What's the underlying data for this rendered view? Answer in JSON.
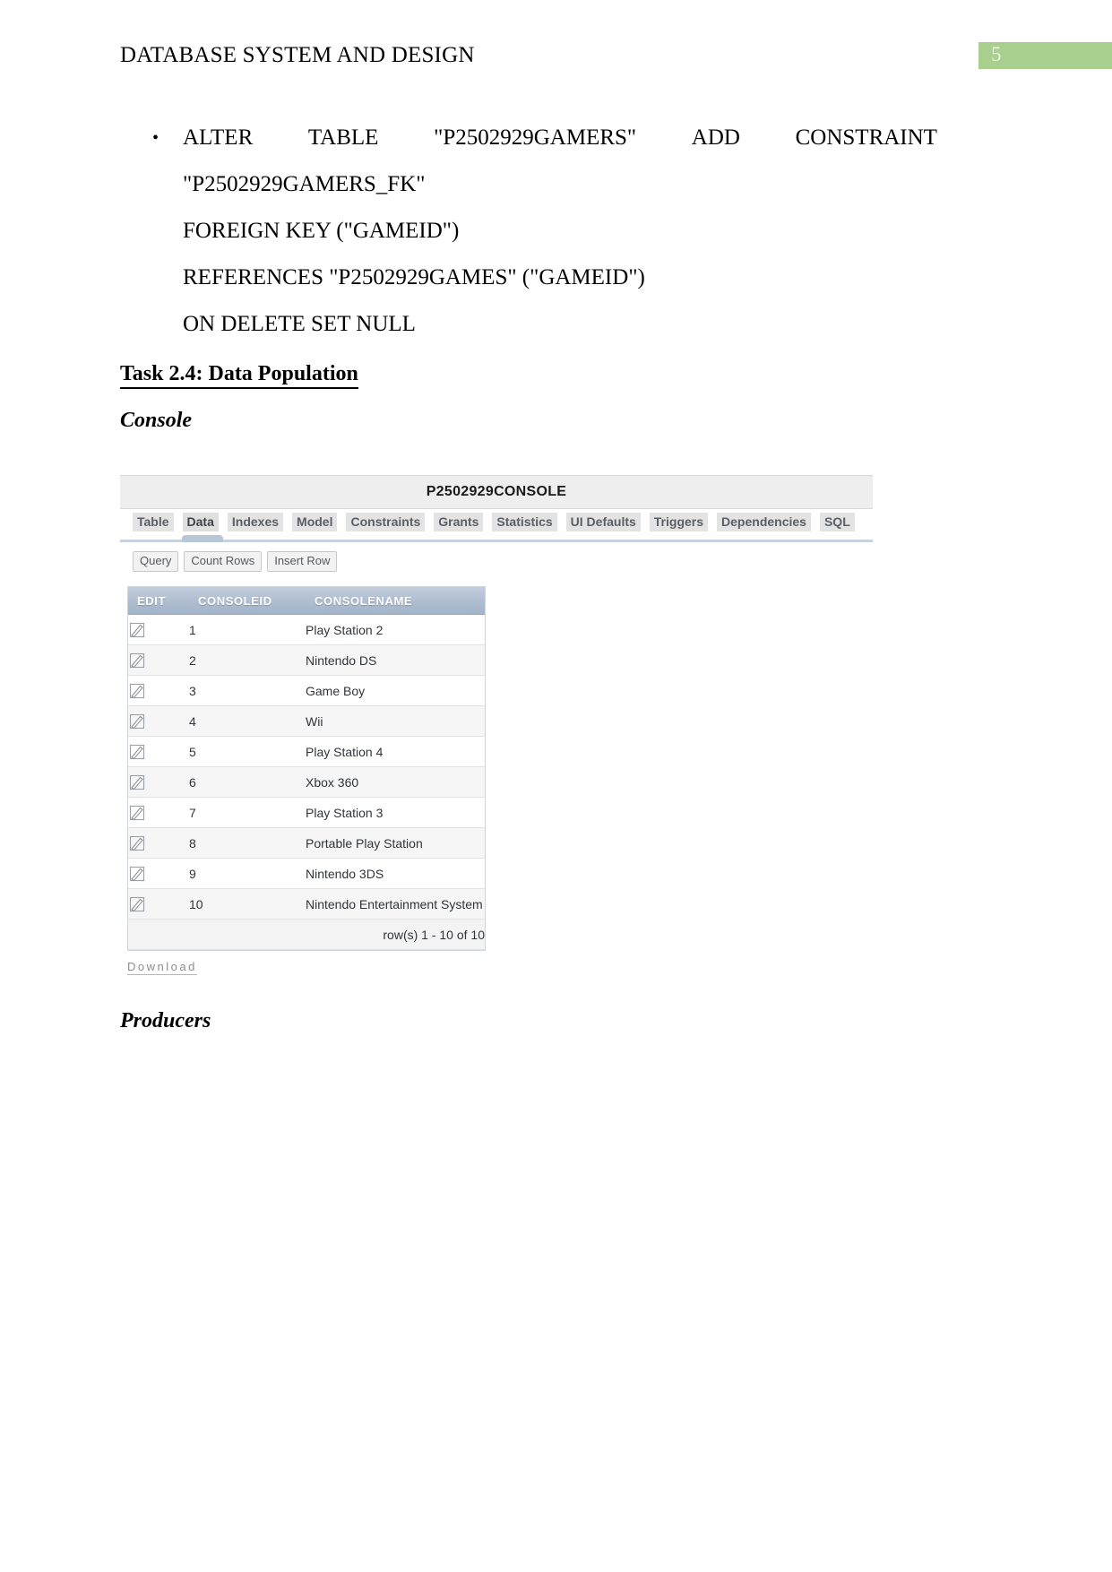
{
  "header": {
    "document_title": "DATABASE SYSTEM AND DESIGN",
    "page_number": "5",
    "badge_color": "#a9cf8f"
  },
  "sql_statement": {
    "bullet_glyph": "•",
    "line1_segments": [
      "ALTER",
      "TABLE",
      "\"P2502929GAMERS\"",
      "ADD",
      "CONSTRAINT"
    ],
    "line2": "\"P2502929GAMERS_FK\"",
    "line3": "FOREIGN KEY (\"GAMEID\")",
    "line4": "REFERENCES \"P2502929GAMES\" (\"GAMEID\")",
    "line5": "ON DELETE SET NULL"
  },
  "headings": {
    "task": "Task 2.4: Data Population ",
    "console": "Console",
    "producers": "Producers"
  },
  "apex": {
    "panel_title": "P2502929CONSOLE",
    "tabs": [
      {
        "label": "Table",
        "active": false
      },
      {
        "label": "Data",
        "active": true
      },
      {
        "label": "Indexes",
        "active": false
      },
      {
        "label": "Model",
        "active": false
      },
      {
        "label": "Constraints",
        "active": false
      },
      {
        "label": "Grants",
        "active": false
      },
      {
        "label": "Statistics",
        "active": false
      },
      {
        "label": "UI Defaults",
        "active": false
      },
      {
        "label": "Triggers",
        "active": false
      },
      {
        "label": "Dependencies",
        "active": false
      },
      {
        "label": "SQL",
        "active": false
      }
    ],
    "buttons": [
      "Query",
      "Count Rows",
      "Insert Row"
    ],
    "grid": {
      "columns": [
        "EDIT",
        "CONSOLEID",
        "CONSOLENAME"
      ],
      "rows": [
        {
          "id": "1",
          "name": "Play Station 2"
        },
        {
          "id": "2",
          "name": "Nintendo DS"
        },
        {
          "id": "3",
          "name": "Game Boy"
        },
        {
          "id": "4",
          "name": "Wii"
        },
        {
          "id": "5",
          "name": "Play Station 4"
        },
        {
          "id": "6",
          "name": "Xbox 360"
        },
        {
          "id": "7",
          "name": "Play Station 3"
        },
        {
          "id": "8",
          "name": "Portable Play Station"
        },
        {
          "id": "9",
          "name": "Nintendo 3DS"
        },
        {
          "id": "10",
          "name": "Nintendo Entertainment System"
        }
      ],
      "footer": "row(s) 1 - 10 of 10"
    },
    "download_label": "Download"
  }
}
